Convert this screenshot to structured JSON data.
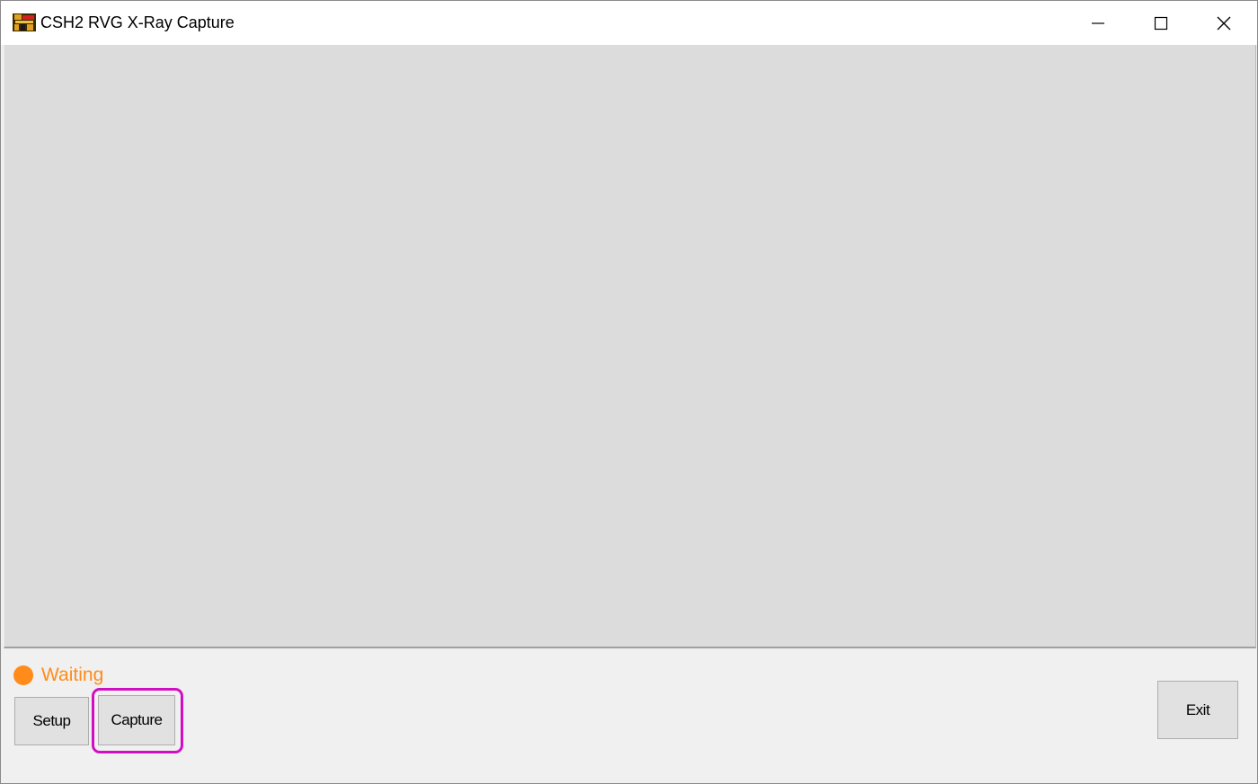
{
  "window": {
    "title": "CSH2 RVG X-Ray Capture",
    "icon": "app-logo-icon",
    "controls": {
      "minimize_icon": "minimize-icon",
      "maximize_icon": "maximize-icon",
      "close_icon": "close-icon"
    }
  },
  "status": {
    "text": "Waiting",
    "color": "#ff8c1a"
  },
  "buttons": {
    "setup_label": "Setup",
    "capture_label": "Capture",
    "exit_label": "Exit"
  },
  "colors": {
    "image_area": "#dcdcdc",
    "panel": "#f0f0f0",
    "highlight": "#d10fc2"
  }
}
